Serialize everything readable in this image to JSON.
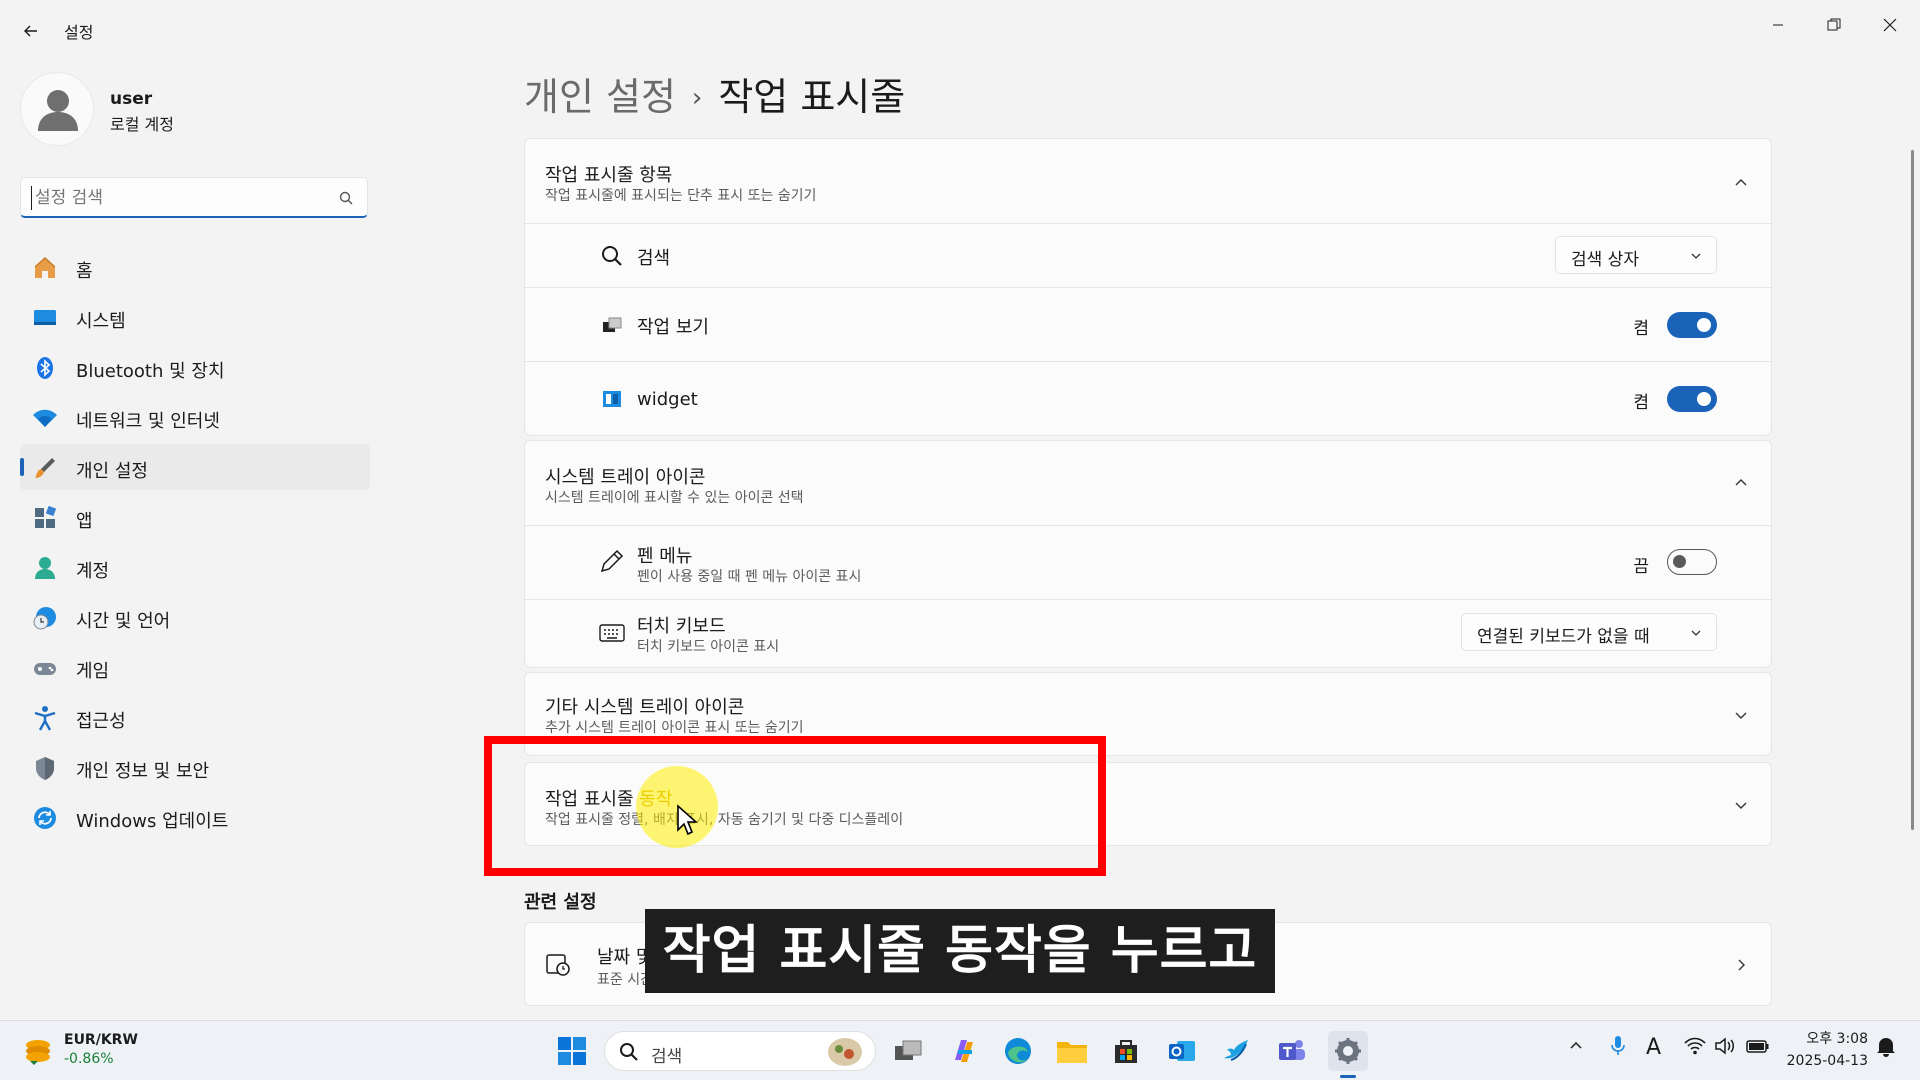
{
  "window": {
    "title": "설정"
  },
  "profile": {
    "name": "user",
    "account_type": "로컬 계정"
  },
  "search": {
    "placeholder": "설정 검색"
  },
  "nav": {
    "items": [
      {
        "label": "홈",
        "icon": "home-icon"
      },
      {
        "label": "시스템",
        "icon": "system-icon"
      },
      {
        "label": "Bluetooth 및 장치",
        "icon": "bluetooth-icon"
      },
      {
        "label": "네트워크 및 인터넷",
        "icon": "network-icon"
      },
      {
        "label": "개인 설정",
        "icon": "personalization-icon",
        "active": true
      },
      {
        "label": "앱",
        "icon": "apps-icon"
      },
      {
        "label": "계정",
        "icon": "account-icon"
      },
      {
        "label": "시간 및 언어",
        "icon": "time-language-icon"
      },
      {
        "label": "게임",
        "icon": "gaming-icon"
      },
      {
        "label": "접근성",
        "icon": "accessibility-icon"
      },
      {
        "label": "개인 정보 및 보안",
        "icon": "privacy-shield-icon"
      },
      {
        "label": "Windows 업데이트",
        "icon": "windows-update-icon"
      }
    ]
  },
  "breadcrumb": {
    "parent": "개인 설정",
    "separator": "›",
    "current": "작업 표시줄"
  },
  "taskbar_items": {
    "title": "작업 표시줄 항목",
    "subtitle": "작업 표시줄에 표시되는 단추 표시 또는 숨기기",
    "rows": [
      {
        "label": "검색",
        "control": "dropdown",
        "value": "검색 상자"
      },
      {
        "label": "작업 보기",
        "control": "toggle",
        "state": "켬"
      },
      {
        "label": "widget",
        "control": "toggle",
        "state": "켬"
      }
    ]
  },
  "system_tray": {
    "title": "시스템 트레이 아이콘",
    "subtitle": "시스템 트레이에 표시할 수 있는 아이콘 선택",
    "rows": [
      {
        "label": "펜 메뉴",
        "sub": "펜이 사용 중일 때 펜 메뉴 아이콘 표시",
        "control": "toggle",
        "state": "끔"
      },
      {
        "label": "터치 키보드",
        "sub": "터치 키보드 아이콘 표시",
        "control": "dropdown",
        "value": "연결된 키보드가 없을 때"
      }
    ]
  },
  "other_tray": {
    "title": "기타 시스템 트레이 아이콘",
    "subtitle": "추가 시스템 트레이 아이콘 표시 또는 숨기기"
  },
  "behaviors": {
    "title_a": "작업 표시줄",
    "title_b": "동작",
    "subtitle": "작업 표시줄 정렬, 배지 표시, 자동 숨기기 및 다중 디스플레이"
  },
  "related": {
    "heading": "관련 설정",
    "item_title": "날짜 및 시간",
    "item_sub": "표준 시간대, 자동 시계 설정, 달력 표시"
  },
  "caption": "작업 표시줄 동작을 누르고",
  "taskbar": {
    "stock_ticker": "EUR/KRW",
    "stock_change": "-0.86%",
    "search_label": "검색",
    "time": "오후 3:08",
    "date": "2025-04-13",
    "ime": "A"
  },
  "colors": {
    "accent": "#1a63b8",
    "highlight_box": "#ff0000",
    "caption_bg": "#1e1e1e"
  }
}
